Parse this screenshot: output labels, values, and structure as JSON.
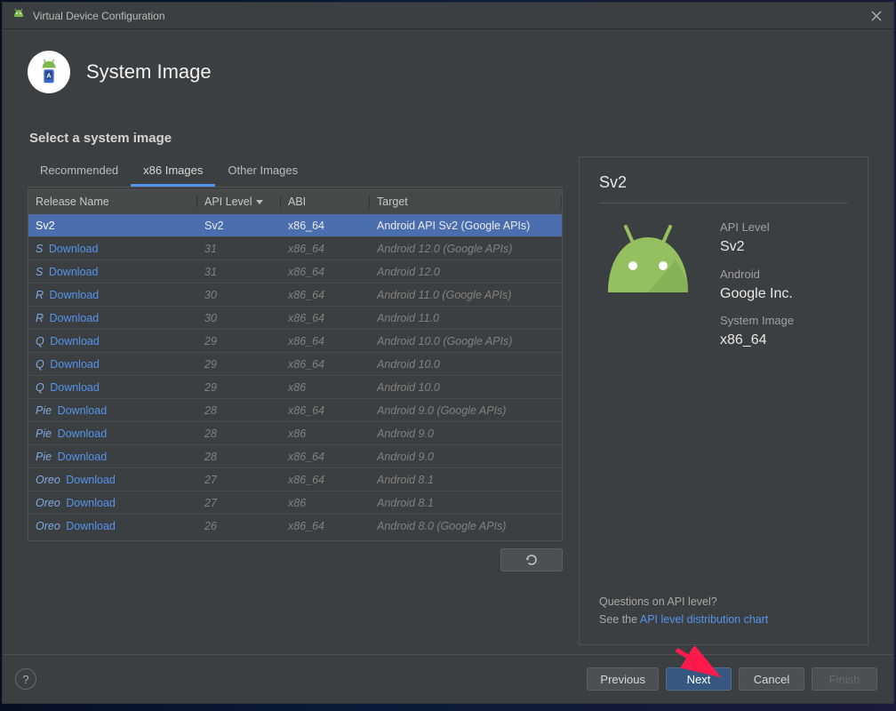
{
  "window": {
    "title": "Virtual Device Configuration"
  },
  "header": {
    "title": "System Image"
  },
  "section_title": "Select a system image",
  "tabs": {
    "recommended": "Recommended",
    "x86": "x86 Images",
    "other": "Other Images"
  },
  "columns": {
    "name": "Release Name",
    "api": "API Level",
    "abi": "ABI",
    "target": "Target"
  },
  "download_label": "Download",
  "rows": [
    {
      "name": "Sv2",
      "download": false,
      "api": "Sv2",
      "abi": "x86_64",
      "target": "Android API Sv2 (Google APIs)",
      "selected": true
    },
    {
      "name": "S",
      "download": true,
      "api": "31",
      "abi": "x86_64",
      "target": "Android 12.0 (Google APIs)"
    },
    {
      "name": "S",
      "download": true,
      "api": "31",
      "abi": "x86_64",
      "target": "Android 12.0"
    },
    {
      "name": "R",
      "download": true,
      "api": "30",
      "abi": "x86_64",
      "target": "Android 11.0 (Google APIs)"
    },
    {
      "name": "R",
      "download": true,
      "api": "30",
      "abi": "x86_64",
      "target": "Android 11.0"
    },
    {
      "name": "Q",
      "download": true,
      "api": "29",
      "abi": "x86_64",
      "target": "Android 10.0 (Google APIs)"
    },
    {
      "name": "Q",
      "download": true,
      "api": "29",
      "abi": "x86_64",
      "target": "Android 10.0"
    },
    {
      "name": "Q",
      "download": true,
      "api": "29",
      "abi": "x86",
      "target": "Android 10.0"
    },
    {
      "name": "Pie",
      "download": true,
      "api": "28",
      "abi": "x86_64",
      "target": "Android 9.0 (Google APIs)"
    },
    {
      "name": "Pie",
      "download": true,
      "api": "28",
      "abi": "x86",
      "target": "Android 9.0"
    },
    {
      "name": "Pie",
      "download": true,
      "api": "28",
      "abi": "x86_64",
      "target": "Android 9.0"
    },
    {
      "name": "Oreo",
      "download": true,
      "api": "27",
      "abi": "x86_64",
      "target": "Android 8.1"
    },
    {
      "name": "Oreo",
      "download": true,
      "api": "27",
      "abi": "x86",
      "target": "Android 8.1"
    },
    {
      "name": "Oreo",
      "download": true,
      "api": "26",
      "abi": "x86_64",
      "target": "Android 8.0 (Google APIs)"
    }
  ],
  "detail": {
    "title": "Sv2",
    "api_label": "API Level",
    "api_value": "Sv2",
    "android_label": "Android",
    "android_value": "Google Inc.",
    "sysimg_label": "System Image",
    "sysimg_value": "x86_64",
    "footer_q": "Questions on API level?",
    "footer_see": "See the ",
    "footer_link": "API level distribution chart"
  },
  "buttons": {
    "previous": "Previous",
    "next": "Next",
    "cancel": "Cancel",
    "finish": "Finish"
  }
}
